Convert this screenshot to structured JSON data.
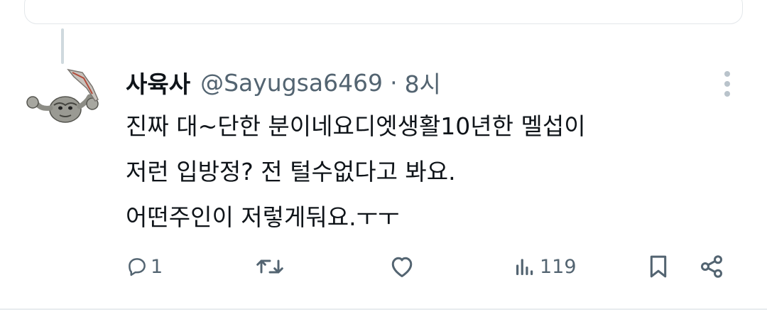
{
  "tweet": {
    "display_name": "사육사",
    "handle": "@Sayugsa6469",
    "separator": "·",
    "time": "8시",
    "text_lines": [
      "진짜 대~단한 분이네요디엣생활10년한 멜섭이",
      "저런 입방정? 전 털수없다고 봐요.",
      "어떤주인이 저렇게둬요.ㅜㅜ"
    ]
  },
  "actions": {
    "reply": {
      "icon": "reply-icon",
      "count": "1"
    },
    "retweet": {
      "icon": "retweet-icon"
    },
    "like": {
      "icon": "heart-icon"
    },
    "views": {
      "icon": "views-icon",
      "count": "119"
    },
    "bookmark": {
      "icon": "bookmark-icon"
    },
    "share": {
      "icon": "share-icon"
    }
  },
  "colors": {
    "text": "#0f1419",
    "secondary": "#536471",
    "border": "#e3e7ea",
    "thread_line": "#cfd9de"
  }
}
